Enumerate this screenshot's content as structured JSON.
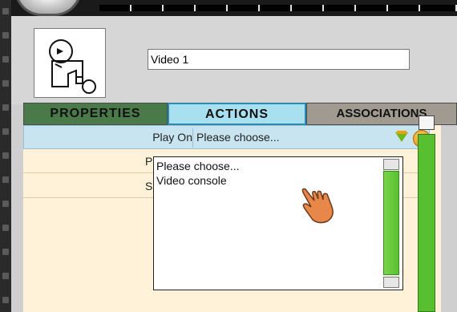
{
  "object": {
    "name_value": "Video 1",
    "thumbnail_icon": "video-camera-icon"
  },
  "tabs": [
    {
      "label": "PROPERTIES",
      "active": false
    },
    {
      "label": "ACTIONS",
      "active": true
    },
    {
      "label": "ASSOCIATIONS",
      "active": false
    }
  ],
  "actions": {
    "play_on_label": "Play On",
    "play_on_value": "Please choose...",
    "sub_rows": [
      {
        "label": "P"
      },
      {
        "label": "S"
      }
    ]
  },
  "dropdown": {
    "options": [
      "Please choose...",
      "Video console"
    ]
  },
  "cursor": {
    "icon": "hand-pointer-icon"
  },
  "colors": {
    "tab_properties": "#4a7a4a",
    "tab_actions": "#a8e0f0",
    "tab_associations": "#a09a90",
    "row_highlight": "#c8e4f0",
    "content_bg": "#fff2d8",
    "scroll_green": "#58c030"
  }
}
